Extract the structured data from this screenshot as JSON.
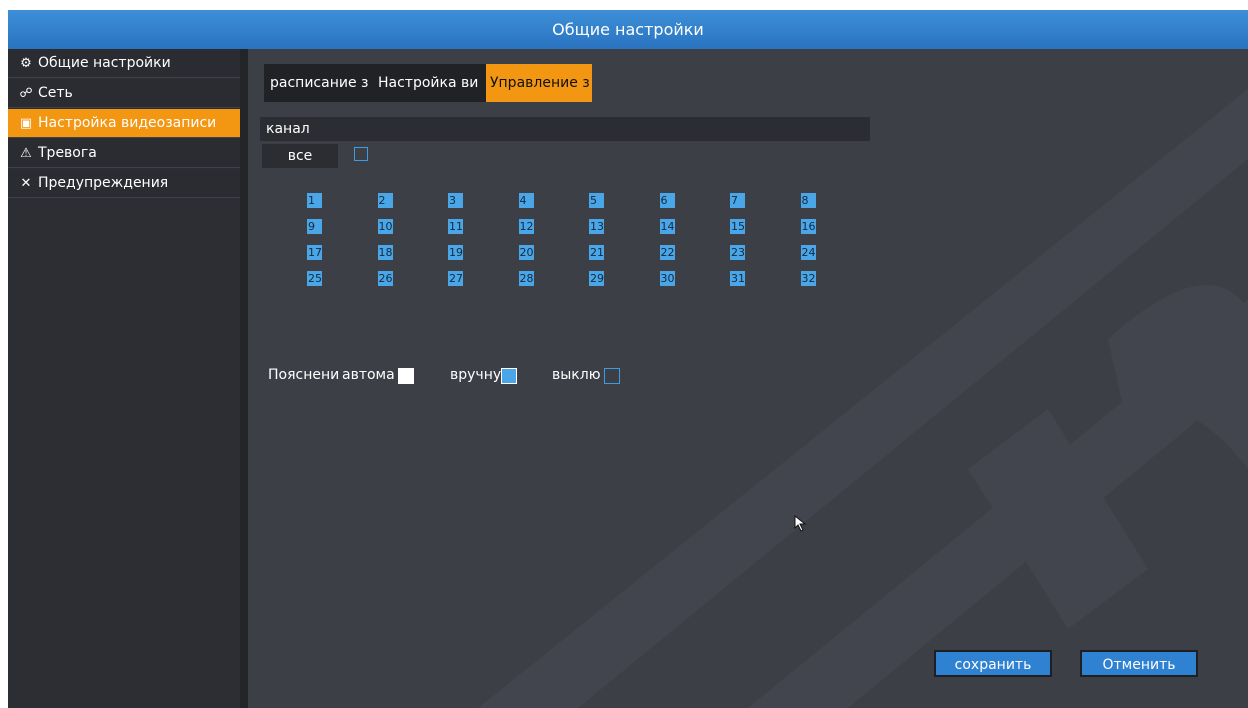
{
  "window": {
    "title": "Общие настройки"
  },
  "sidebar": {
    "items": [
      {
        "label": "Общие настройки",
        "icon": "gear-icon",
        "active": false
      },
      {
        "label": "Сеть",
        "icon": "network-icon",
        "active": false
      },
      {
        "label": "Настройка видеозаписи",
        "icon": "film-icon",
        "active": true
      },
      {
        "label": "Тревога",
        "icon": "warning-icon",
        "active": false
      },
      {
        "label": "Предупреждения",
        "icon": "tools-icon",
        "active": false
      }
    ]
  },
  "tabs": [
    {
      "label": "расписание з",
      "active": false
    },
    {
      "label": "Настройка ви",
      "active": false
    },
    {
      "label": "Управление з",
      "active": true
    }
  ],
  "channel": {
    "label": "канал",
    "all_label": "все",
    "numbers": [
      "1",
      "2",
      "3",
      "4",
      "5",
      "6",
      "7",
      "8",
      "9",
      "10",
      "11",
      "12",
      "13",
      "14",
      "15",
      "16",
      "17",
      "18",
      "19",
      "20",
      "21",
      "22",
      "23",
      "24",
      "25",
      "26",
      "27",
      "28",
      "29",
      "30",
      "31",
      "32"
    ]
  },
  "legend": {
    "title": "Пояснени",
    "auto": "автома",
    "manual": "вручну",
    "off": "выклю"
  },
  "buttons": {
    "save": "сохранить",
    "cancel": "Отменить"
  },
  "colors": {
    "accent": "#f39612",
    "title_bar": "#2f80cf",
    "checkbox": "#4aa6e6",
    "button": "#2f82d1"
  }
}
